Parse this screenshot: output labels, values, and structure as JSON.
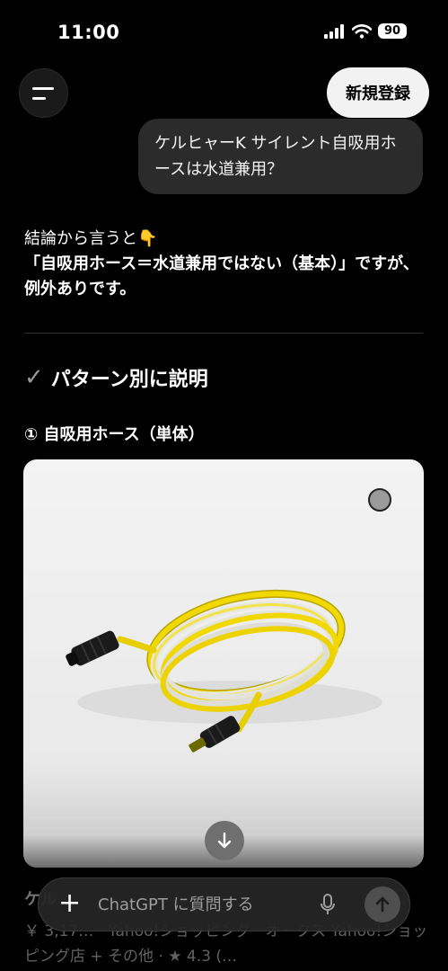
{
  "status_bar": {
    "time": "11:00",
    "battery": "90"
  },
  "header": {
    "signup_label": "新規登録"
  },
  "user_message": {
    "text": "ケルヒャーK サイレント自吸用ホースは水道兼用？"
  },
  "answer": {
    "intro": "結論から言うと",
    "intro_emoji": "👇",
    "conclusion_bold": "「自吸用ホース＝水道兼用ではない（基本）」です",
    "conclusion_rest": "が、例外ありです。",
    "section_check": "✓",
    "section_title": "パターン別に説明",
    "sub_heading": "① 自吸用ホース（単体）"
  },
  "product": {
    "title": "ケル",
    "meta": "￥ 3,17… · Yahoo!ショッピング · オークス Yahoo!ショッピング店 + その他 · ★ 4.3 (…"
  },
  "composer": {
    "placeholder": "ChatGPT に質問する"
  },
  "icons": {
    "menu": "menu-icon",
    "plus": "plus-icon",
    "mic": "mic-icon",
    "send": "arrow-up-icon",
    "scroll": "arrow-down-icon",
    "signal": "signal-icon",
    "wifi": "wifi-icon"
  }
}
